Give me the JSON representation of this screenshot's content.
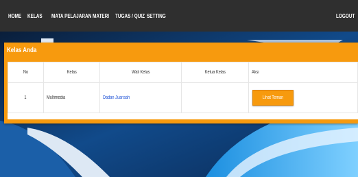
{
  "nav": {
    "items": [
      "HOME",
      "KELAS",
      "MATA PELAJARAN",
      "MATERI",
      "TUGAS / QUIZ",
      "SETTING"
    ],
    "logout": "LOGOUT"
  },
  "panel": {
    "title": "Kelas Anda",
    "headers": [
      "No",
      "Kelas",
      "Wali Kelas",
      "Ketua Kelas",
      "Aksi"
    ],
    "rows": [
      {
        "no": "1",
        "kelas": "Multimedia",
        "wali": "Dadan Juansah",
        "ketua": "",
        "aksi": "Lihat Teman"
      }
    ]
  },
  "colors": {
    "navbar": "#2f2f2f",
    "accent": "#f79a0e",
    "link": "#1a4fd6"
  }
}
